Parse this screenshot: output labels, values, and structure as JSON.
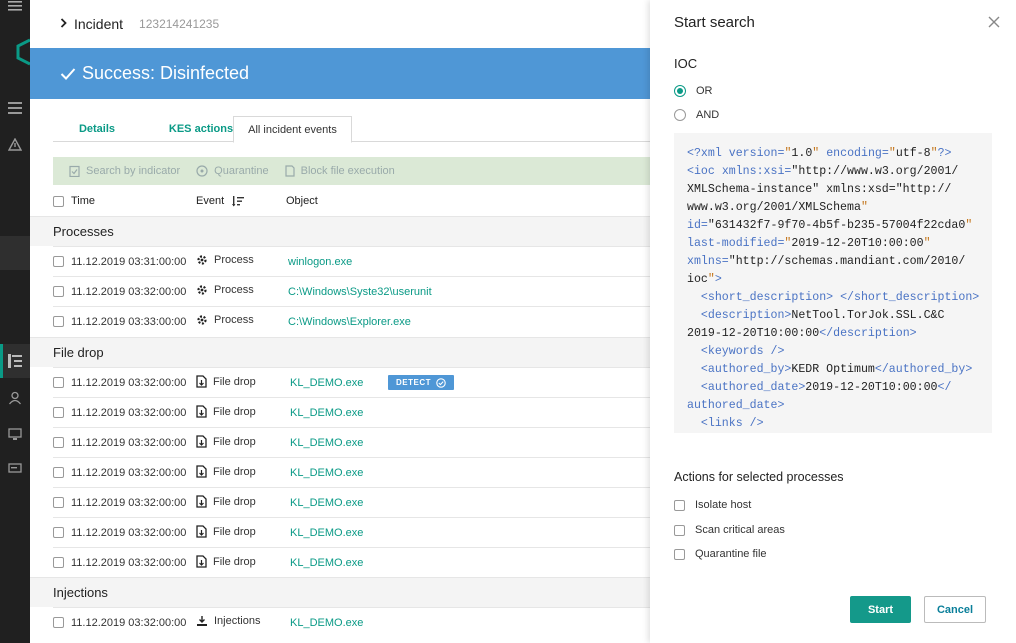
{
  "header": {
    "breadcrumb_title": "Incident",
    "incident_id": "123214241235"
  },
  "banner": {
    "text": "Success: Disinfected"
  },
  "tabs": [
    {
      "label": "Details",
      "active": false
    },
    {
      "label": "KES actions",
      "active": false
    },
    {
      "label": "All incident events",
      "active": true
    }
  ],
  "toolbar": {
    "search": "Search by indicator",
    "quarantine": "Quarantine",
    "block": "Block file execution"
  },
  "table": {
    "columns": {
      "time": "Time",
      "event": "Event",
      "object": "Object"
    },
    "groups": [
      {
        "name": "Processes",
        "rows": [
          {
            "time": "11.12.2019 03:31:00:00",
            "event": "Process",
            "object": "winlogon.exe"
          },
          {
            "time": "11.12.2019 03:32:00:00",
            "event": "Process",
            "object": "C:\\Windows\\Syste32\\userunit"
          },
          {
            "time": "11.12.2019 03:33:00:00",
            "event": "Process",
            "object": "C:\\Windows\\Explorer.exe"
          }
        ]
      },
      {
        "name": "File drop",
        "rows": [
          {
            "time": "11.12.2019 03:32:00:00",
            "event": "File drop",
            "object": "KL_DEMO.exe",
            "badge": "DETECT"
          },
          {
            "time": "11.12.2019 03:32:00:00",
            "event": "File drop",
            "object": "KL_DEMO.exe"
          },
          {
            "time": "11.12.2019 03:32:00:00",
            "event": "File drop",
            "object": "KL_DEMO.exe"
          },
          {
            "time": "11.12.2019 03:32:00:00",
            "event": "File drop",
            "object": "KL_DEMO.exe"
          },
          {
            "time": "11.12.2019 03:32:00:00",
            "event": "File drop",
            "object": "KL_DEMO.exe"
          },
          {
            "time": "11.12.2019 03:32:00:00",
            "event": "File drop",
            "object": "KL_DEMO.exe"
          },
          {
            "time": "11.12.2019 03:32:00:00",
            "event": "File drop",
            "object": "KL_DEMO.exe"
          }
        ]
      },
      {
        "name": "Injections",
        "rows": [
          {
            "time": "11.12.2019 03:32:00:00",
            "event": "Injections",
            "object": "KL_DEMO.exe"
          }
        ]
      }
    ]
  },
  "panel": {
    "title": "Start search",
    "ioc_label": "IOC",
    "radio_or": "OR",
    "radio_and": "AND",
    "actions_title": "Actions for selected processes",
    "actions": [
      "Isolate host",
      "Scan critical areas",
      "Quarantine file"
    ],
    "start": "Start",
    "cancel": "Cancel"
  },
  "colors": {
    "accent": "#0a9a86",
    "banner": "#4f97d6",
    "rail": "#202020",
    "toolbar": "#dbe9d6"
  }
}
